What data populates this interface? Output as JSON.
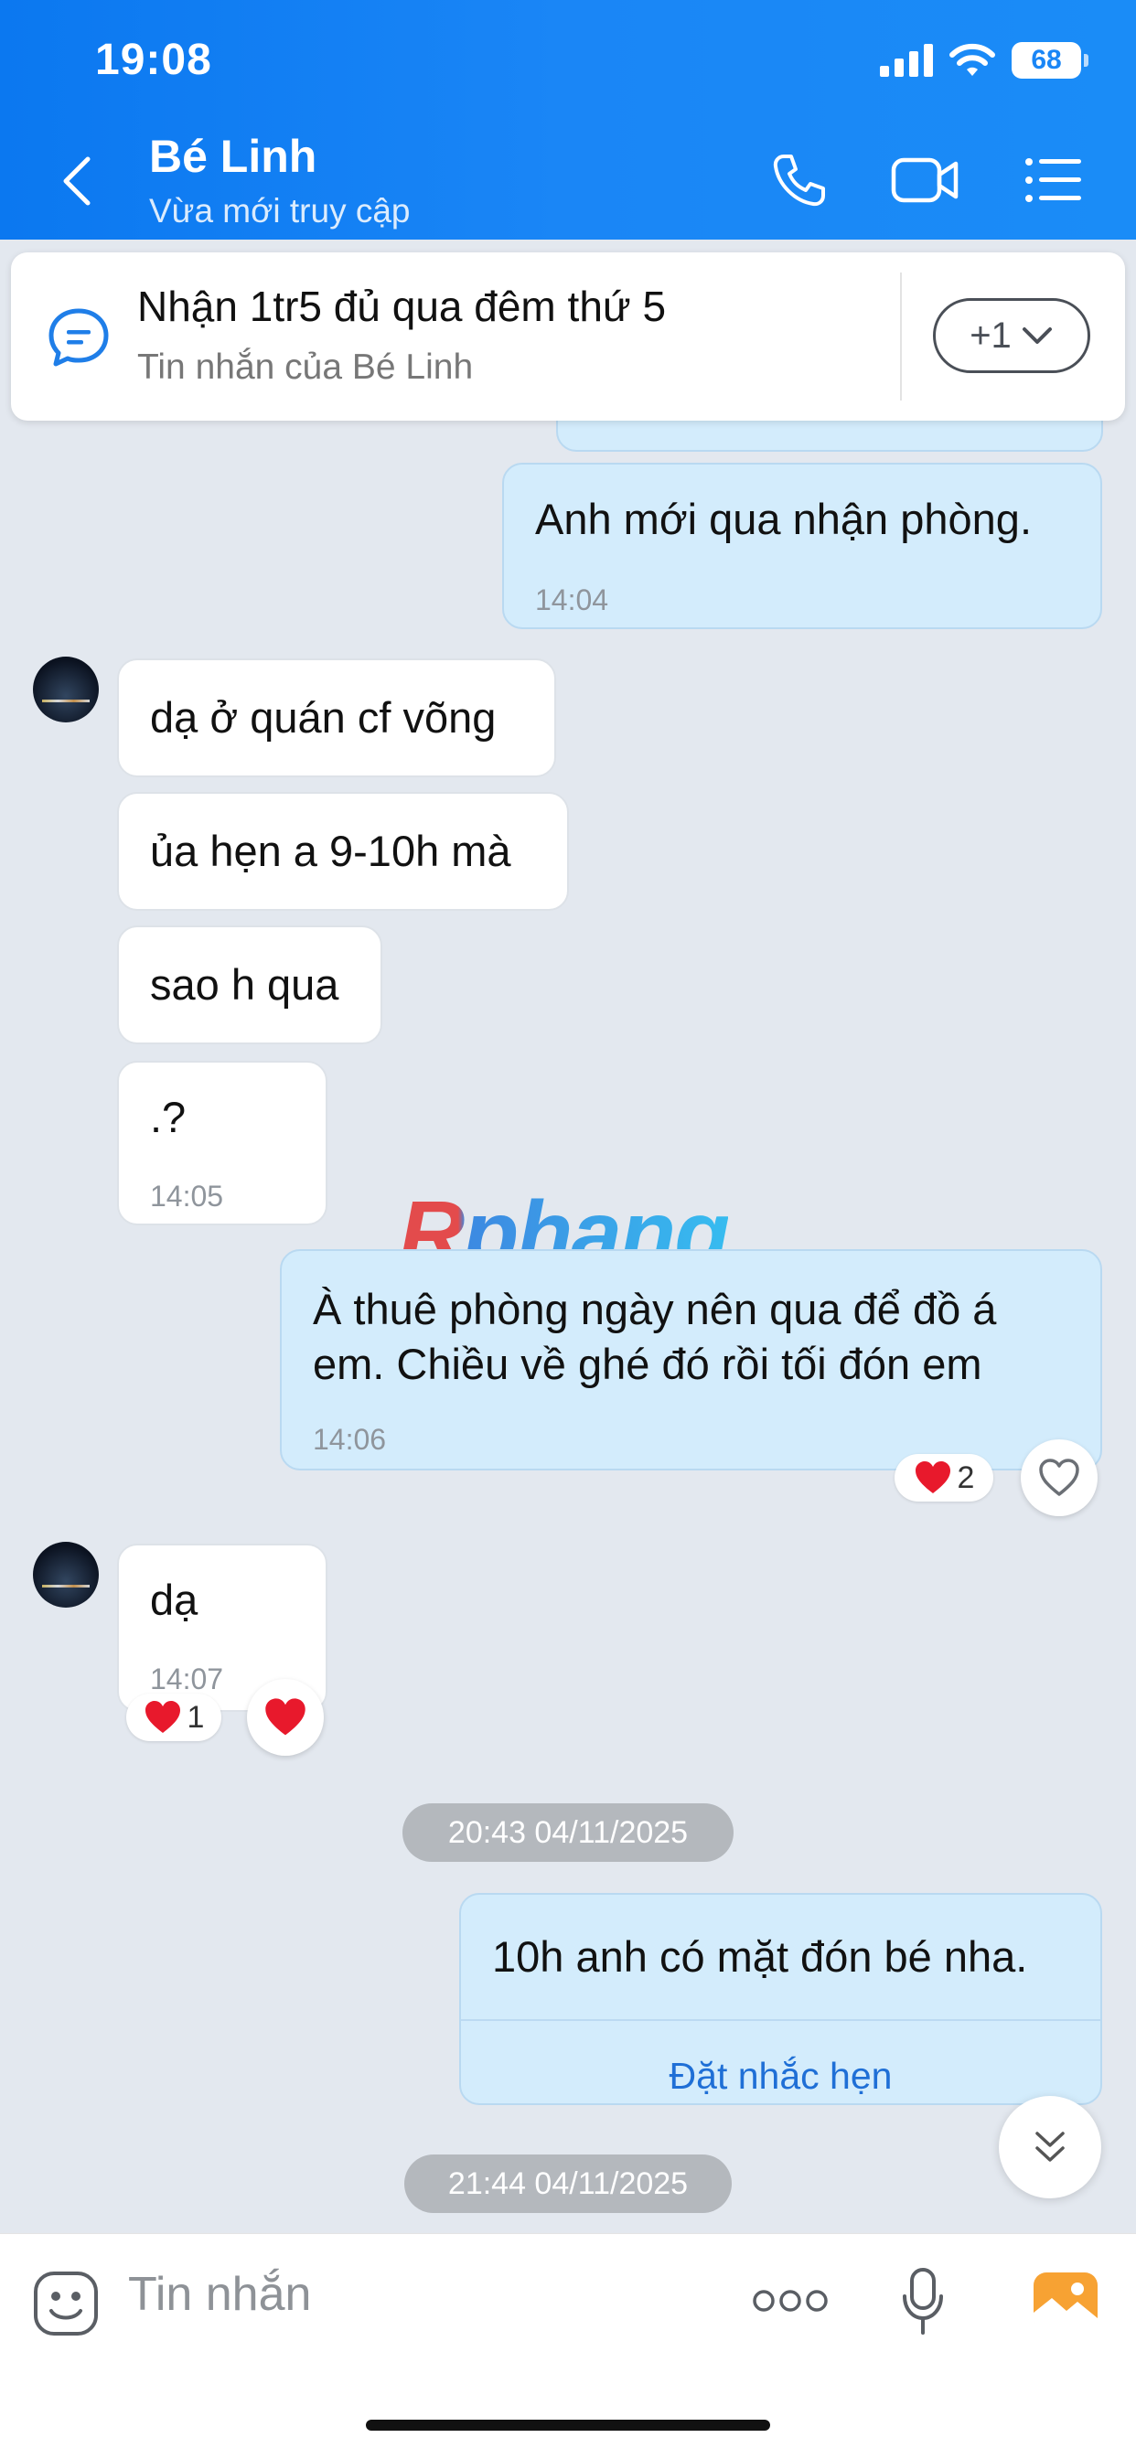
{
  "status_bar": {
    "time": "19:08",
    "battery": "68"
  },
  "header": {
    "name": "Bé Linh",
    "status": "Vừa mới truy cập"
  },
  "pinned": {
    "title": "Nhận 1tr5 đủ qua đêm thứ 5",
    "subtitle": "Tin nhắn của Bé Linh",
    "more": "+1"
  },
  "messages": [
    {
      "from": "me",
      "text": "Anh mới qua nhận phòng.",
      "time": "14:04"
    },
    {
      "from": "them",
      "text": "dạ ở quán cf võng"
    },
    {
      "from": "them",
      "text": "ủa hẹn a 9-10h mà"
    },
    {
      "from": "them",
      "text": "sao h qua"
    },
    {
      "from": "them",
      "text": ".?",
      "time": "14:05"
    },
    {
      "from": "me",
      "text_line1": "À thuê phòng ngày nên qua để đồ á",
      "text_line2": "em. Chiều về ghé đó rồi tối đón em",
      "time": "14:06",
      "reaction_count": "2"
    },
    {
      "from": "them",
      "text": "dạ",
      "time": "14:07",
      "reaction_count": "1"
    },
    {
      "from": "me",
      "text": "10h anh có mặt đón bé nha.",
      "action": "Đặt nhắc hẹn"
    }
  ],
  "date_chips": [
    "20:43 04/11/2025",
    "21:44 04/11/2025"
  ],
  "watermark": "Rphang",
  "composer": {
    "placeholder": "Tin nhắn",
    "more": "ooo"
  },
  "colors": {
    "header": "#1a86f6",
    "my_bubble": "#d3ecfc",
    "their_bubble": "#ffffff",
    "background": "#e3e8ef",
    "link": "#1f6fd6"
  },
  "icons": [
    "back-icon",
    "phone-icon",
    "video-icon",
    "menu-list-icon",
    "chat-bubble-icon",
    "chevron-down-icon",
    "heart-icon",
    "double-chevron-down-icon",
    "emoji-icon",
    "mic-icon",
    "image-icon"
  ]
}
